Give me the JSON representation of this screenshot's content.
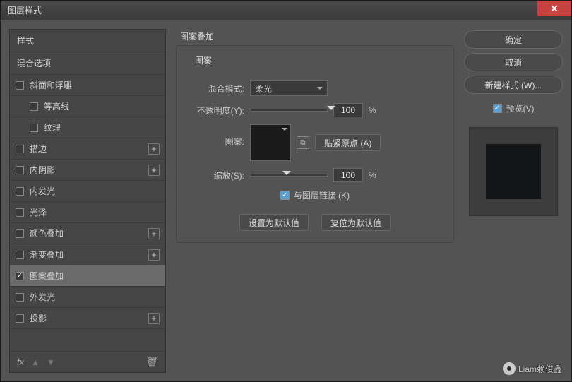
{
  "window": {
    "title": "图层样式"
  },
  "sidebar": {
    "header1": "样式",
    "header2": "混合选项",
    "items": [
      {
        "label": "斜面和浮雕",
        "checked": false,
        "hasPlus": false,
        "indent": false
      },
      {
        "label": "等高线",
        "checked": false,
        "hasPlus": false,
        "indent": true
      },
      {
        "label": "纹理",
        "checked": false,
        "hasPlus": false,
        "indent": true
      },
      {
        "label": "描边",
        "checked": false,
        "hasPlus": true,
        "indent": false
      },
      {
        "label": "内阴影",
        "checked": false,
        "hasPlus": true,
        "indent": false
      },
      {
        "label": "内发光",
        "checked": false,
        "hasPlus": false,
        "indent": false
      },
      {
        "label": "光泽",
        "checked": false,
        "hasPlus": false,
        "indent": false
      },
      {
        "label": "颜色叠加",
        "checked": false,
        "hasPlus": true,
        "indent": false
      },
      {
        "label": "渐变叠加",
        "checked": false,
        "hasPlus": true,
        "indent": false
      },
      {
        "label": "图案叠加",
        "checked": true,
        "hasPlus": false,
        "indent": false,
        "selected": true
      },
      {
        "label": "外发光",
        "checked": false,
        "hasPlus": false,
        "indent": false
      },
      {
        "label": "投影",
        "checked": false,
        "hasPlus": true,
        "indent": false
      }
    ],
    "footer": {
      "fx": "fx"
    }
  },
  "center": {
    "panelTitle": "图案叠加",
    "legend": "图案",
    "blendMode": {
      "label": "混合模式:",
      "value": "柔光"
    },
    "opacity": {
      "label": "不透明度(Y):",
      "value": "100",
      "unit": "%",
      "pos": 100
    },
    "pattern": {
      "label": "图案:",
      "snapBtn": "贴紧原点 (A)"
    },
    "scale": {
      "label": "缩放(S):",
      "value": "100",
      "unit": "%",
      "pos": 42
    },
    "link": {
      "label": "与图层链接 (K)",
      "checked": true
    },
    "setDefault": "设置为默认值",
    "resetDefault": "复位为默认值"
  },
  "right": {
    "ok": "确定",
    "cancel": "取消",
    "newStyle": "新建样式 (W)...",
    "preview": "预览(V)"
  },
  "watermark": "Liam赖俊鑫"
}
